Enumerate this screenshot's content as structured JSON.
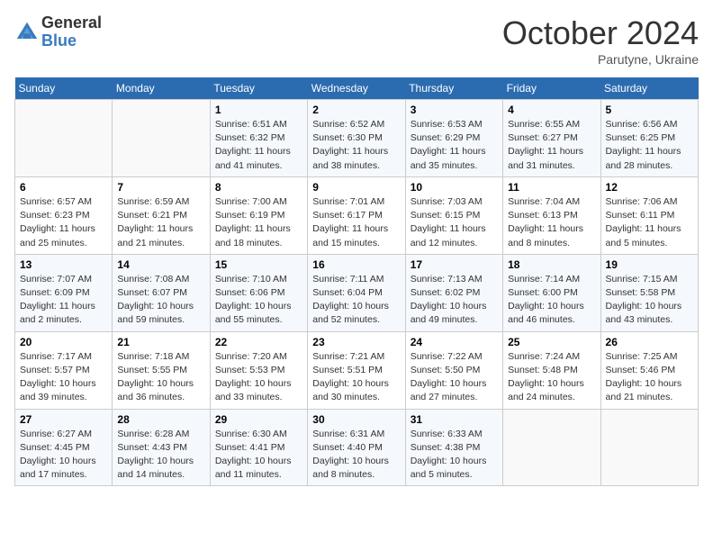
{
  "header": {
    "logo_general": "General",
    "logo_blue": "Blue",
    "month_year": "October 2024",
    "location": "Parutyne, Ukraine"
  },
  "days_of_week": [
    "Sunday",
    "Monday",
    "Tuesday",
    "Wednesday",
    "Thursday",
    "Friday",
    "Saturday"
  ],
  "weeks": [
    [
      {
        "day": "",
        "info": ""
      },
      {
        "day": "",
        "info": ""
      },
      {
        "day": "1",
        "info": "Sunrise: 6:51 AM\nSunset: 6:32 PM\nDaylight: 11 hours and 41 minutes."
      },
      {
        "day": "2",
        "info": "Sunrise: 6:52 AM\nSunset: 6:30 PM\nDaylight: 11 hours and 38 minutes."
      },
      {
        "day": "3",
        "info": "Sunrise: 6:53 AM\nSunset: 6:29 PM\nDaylight: 11 hours and 35 minutes."
      },
      {
        "day": "4",
        "info": "Sunrise: 6:55 AM\nSunset: 6:27 PM\nDaylight: 11 hours and 31 minutes."
      },
      {
        "day": "5",
        "info": "Sunrise: 6:56 AM\nSunset: 6:25 PM\nDaylight: 11 hours and 28 minutes."
      }
    ],
    [
      {
        "day": "6",
        "info": "Sunrise: 6:57 AM\nSunset: 6:23 PM\nDaylight: 11 hours and 25 minutes."
      },
      {
        "day": "7",
        "info": "Sunrise: 6:59 AM\nSunset: 6:21 PM\nDaylight: 11 hours and 21 minutes."
      },
      {
        "day": "8",
        "info": "Sunrise: 7:00 AM\nSunset: 6:19 PM\nDaylight: 11 hours and 18 minutes."
      },
      {
        "day": "9",
        "info": "Sunrise: 7:01 AM\nSunset: 6:17 PM\nDaylight: 11 hours and 15 minutes."
      },
      {
        "day": "10",
        "info": "Sunrise: 7:03 AM\nSunset: 6:15 PM\nDaylight: 11 hours and 12 minutes."
      },
      {
        "day": "11",
        "info": "Sunrise: 7:04 AM\nSunset: 6:13 PM\nDaylight: 11 hours and 8 minutes."
      },
      {
        "day": "12",
        "info": "Sunrise: 7:06 AM\nSunset: 6:11 PM\nDaylight: 11 hours and 5 minutes."
      }
    ],
    [
      {
        "day": "13",
        "info": "Sunrise: 7:07 AM\nSunset: 6:09 PM\nDaylight: 11 hours and 2 minutes."
      },
      {
        "day": "14",
        "info": "Sunrise: 7:08 AM\nSunset: 6:07 PM\nDaylight: 10 hours and 59 minutes."
      },
      {
        "day": "15",
        "info": "Sunrise: 7:10 AM\nSunset: 6:06 PM\nDaylight: 10 hours and 55 minutes."
      },
      {
        "day": "16",
        "info": "Sunrise: 7:11 AM\nSunset: 6:04 PM\nDaylight: 10 hours and 52 minutes."
      },
      {
        "day": "17",
        "info": "Sunrise: 7:13 AM\nSunset: 6:02 PM\nDaylight: 10 hours and 49 minutes."
      },
      {
        "day": "18",
        "info": "Sunrise: 7:14 AM\nSunset: 6:00 PM\nDaylight: 10 hours and 46 minutes."
      },
      {
        "day": "19",
        "info": "Sunrise: 7:15 AM\nSunset: 5:58 PM\nDaylight: 10 hours and 43 minutes."
      }
    ],
    [
      {
        "day": "20",
        "info": "Sunrise: 7:17 AM\nSunset: 5:57 PM\nDaylight: 10 hours and 39 minutes."
      },
      {
        "day": "21",
        "info": "Sunrise: 7:18 AM\nSunset: 5:55 PM\nDaylight: 10 hours and 36 minutes."
      },
      {
        "day": "22",
        "info": "Sunrise: 7:20 AM\nSunset: 5:53 PM\nDaylight: 10 hours and 33 minutes."
      },
      {
        "day": "23",
        "info": "Sunrise: 7:21 AM\nSunset: 5:51 PM\nDaylight: 10 hours and 30 minutes."
      },
      {
        "day": "24",
        "info": "Sunrise: 7:22 AM\nSunset: 5:50 PM\nDaylight: 10 hours and 27 minutes."
      },
      {
        "day": "25",
        "info": "Sunrise: 7:24 AM\nSunset: 5:48 PM\nDaylight: 10 hours and 24 minutes."
      },
      {
        "day": "26",
        "info": "Sunrise: 7:25 AM\nSunset: 5:46 PM\nDaylight: 10 hours and 21 minutes."
      }
    ],
    [
      {
        "day": "27",
        "info": "Sunrise: 6:27 AM\nSunset: 4:45 PM\nDaylight: 10 hours and 17 minutes."
      },
      {
        "day": "28",
        "info": "Sunrise: 6:28 AM\nSunset: 4:43 PM\nDaylight: 10 hours and 14 minutes."
      },
      {
        "day": "29",
        "info": "Sunrise: 6:30 AM\nSunset: 4:41 PM\nDaylight: 10 hours and 11 minutes."
      },
      {
        "day": "30",
        "info": "Sunrise: 6:31 AM\nSunset: 4:40 PM\nDaylight: 10 hours and 8 minutes."
      },
      {
        "day": "31",
        "info": "Sunrise: 6:33 AM\nSunset: 4:38 PM\nDaylight: 10 hours and 5 minutes."
      },
      {
        "day": "",
        "info": ""
      },
      {
        "day": "",
        "info": ""
      }
    ]
  ]
}
